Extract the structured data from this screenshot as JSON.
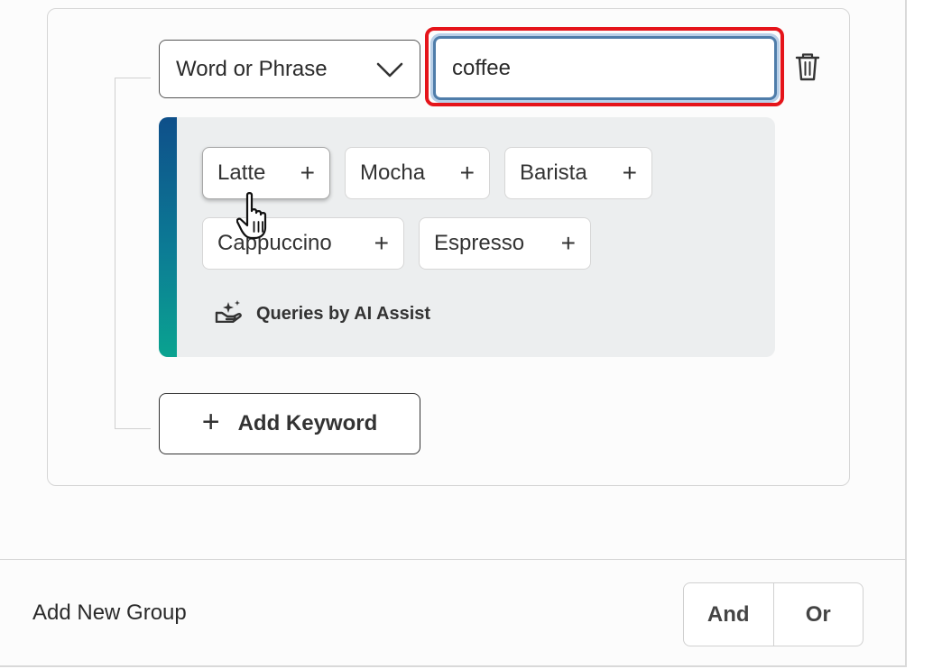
{
  "keyword_row": {
    "match_type": "Word or Phrase",
    "keyword_value": "coffee"
  },
  "suggestions": {
    "chips": [
      {
        "label": "Latte",
        "action": "+"
      },
      {
        "label": "Mocha",
        "action": "+"
      },
      {
        "label": "Barista",
        "action": "+"
      },
      {
        "label": "Cappuccino",
        "action": "+"
      },
      {
        "label": "Espresso",
        "action": "+"
      }
    ],
    "footer_label": "Queries by AI Assist",
    "accent_gradient": [
      "#0e4f8a",
      "#0aa390"
    ]
  },
  "add_keyword": {
    "icon": "+",
    "label": "Add Keyword"
  },
  "footer": {
    "add_group_label": "Add New Group",
    "and_label": "And",
    "or_label": "Or"
  },
  "colors": {
    "highlight": "#e5141a",
    "focus_border": "#4f7daa"
  }
}
